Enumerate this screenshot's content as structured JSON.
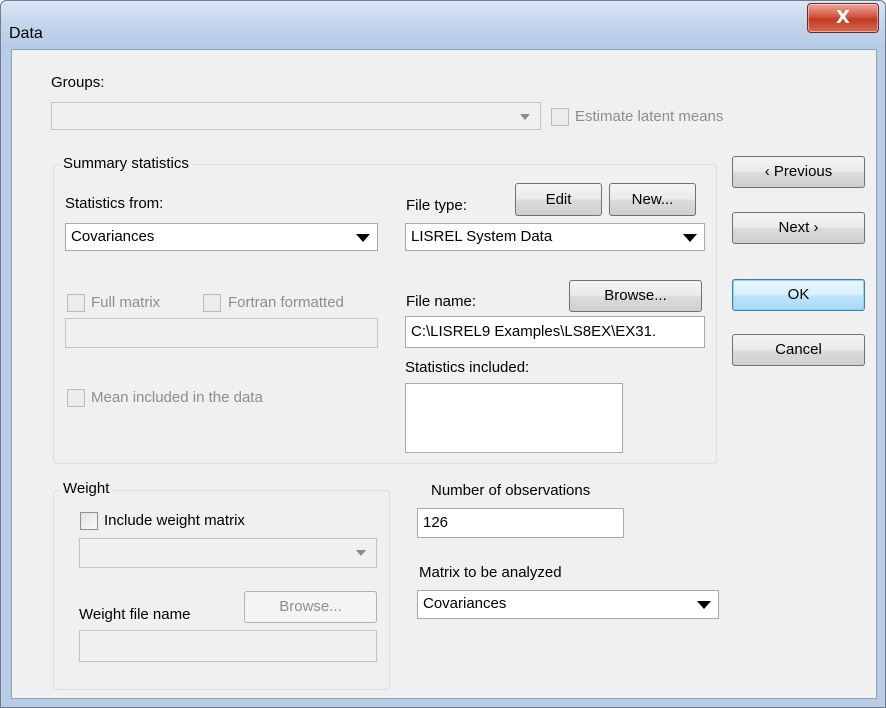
{
  "window": {
    "title": "Data",
    "close_glyph": "X"
  },
  "groups": {
    "label": "Groups:",
    "value": "",
    "estimate_latent_means": "Estimate latent means"
  },
  "summary": {
    "title": "Summary statistics",
    "statistics_from_label": "Statistics from:",
    "statistics_from_value": "Covariances",
    "file_type_label": "File type:",
    "edit_label": "Edit",
    "new_label": "New...",
    "file_type_value": "LISREL System Data",
    "full_matrix": "Full matrix",
    "fortran_formatted": "Fortran formatted",
    "fortran_value": "",
    "file_name_label": "File name:",
    "browse_label": "Browse...",
    "file_name_value": "C:\\LISREL9 Examples\\LS8EX\\EX31.",
    "statistics_included_label": "Statistics included:",
    "mean_included": "Mean included in the data"
  },
  "weight": {
    "title": "Weight",
    "include_weight_matrix": "Include weight matrix",
    "weight_combo_value": "",
    "weight_file_name_label": "Weight file name",
    "browse_label": "Browse...",
    "weight_file_value": ""
  },
  "observations": {
    "label": "Number of observations",
    "value": "126"
  },
  "matrix": {
    "label": "Matrix to be analyzed",
    "value": "Covariances"
  },
  "buttons": {
    "previous": "‹ Previous",
    "next": "Next ›",
    "ok": "OK",
    "cancel": "Cancel"
  }
}
